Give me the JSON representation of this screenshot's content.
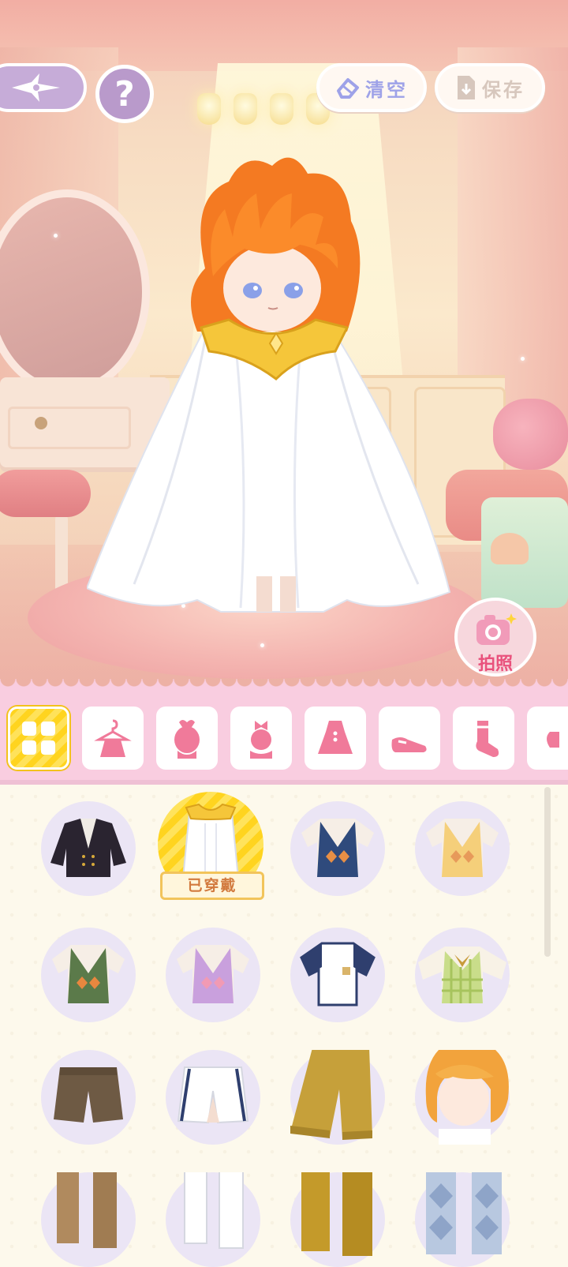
{
  "toolbar": {
    "clear_label": "清空",
    "save_label": "保存",
    "help_label": "?"
  },
  "camera": {
    "label": "拍照"
  },
  "tabs": [
    {
      "name": "all",
      "icon": "grid-icon",
      "active": true
    },
    {
      "name": "outfit-set",
      "icon": "dress-hanger-icon",
      "active": false
    },
    {
      "name": "hair",
      "icon": "hair-bun-icon",
      "active": false
    },
    {
      "name": "accessory",
      "icon": "head-bow-icon",
      "active": false
    },
    {
      "name": "dress",
      "icon": "dress-icon",
      "active": false
    },
    {
      "name": "shoes",
      "icon": "shoe-icon",
      "active": false
    },
    {
      "name": "socks",
      "icon": "sock-icon",
      "active": false
    },
    {
      "name": "more",
      "icon": "partial-icon",
      "active": false
    }
  ],
  "items": [
    {
      "name": "black-jacket",
      "selected": false
    },
    {
      "name": "white-cape-gold-collar",
      "selected": true,
      "badge": "已穿戴"
    },
    {
      "name": "navy-argyle-vest",
      "selected": false
    },
    {
      "name": "yellow-argyle-vest",
      "selected": false
    },
    {
      "name": "green-argyle-vest",
      "selected": false
    },
    {
      "name": "purple-argyle-vest",
      "selected": false
    },
    {
      "name": "white-navy-tshirt",
      "selected": false
    },
    {
      "name": "green-check-vest",
      "selected": false
    },
    {
      "name": "brown-shorts",
      "selected": false
    },
    {
      "name": "white-striped-shorts",
      "selected": false
    },
    {
      "name": "mustard-pants",
      "selected": false
    },
    {
      "name": "orange-bob-hair",
      "selected": false
    },
    {
      "name": "tan-boots",
      "selected": false
    },
    {
      "name": "white-boots",
      "selected": false
    },
    {
      "name": "mustard-boots",
      "selected": false
    },
    {
      "name": "argyle-socks",
      "selected": false
    }
  ],
  "colors": {
    "tab_bar": "#f9cde0",
    "tab_icon": "#f07a9a",
    "active_tab": "#ffd41f",
    "accent_lavender": "#c6acd8",
    "clear_text": "#9ea2e8"
  }
}
